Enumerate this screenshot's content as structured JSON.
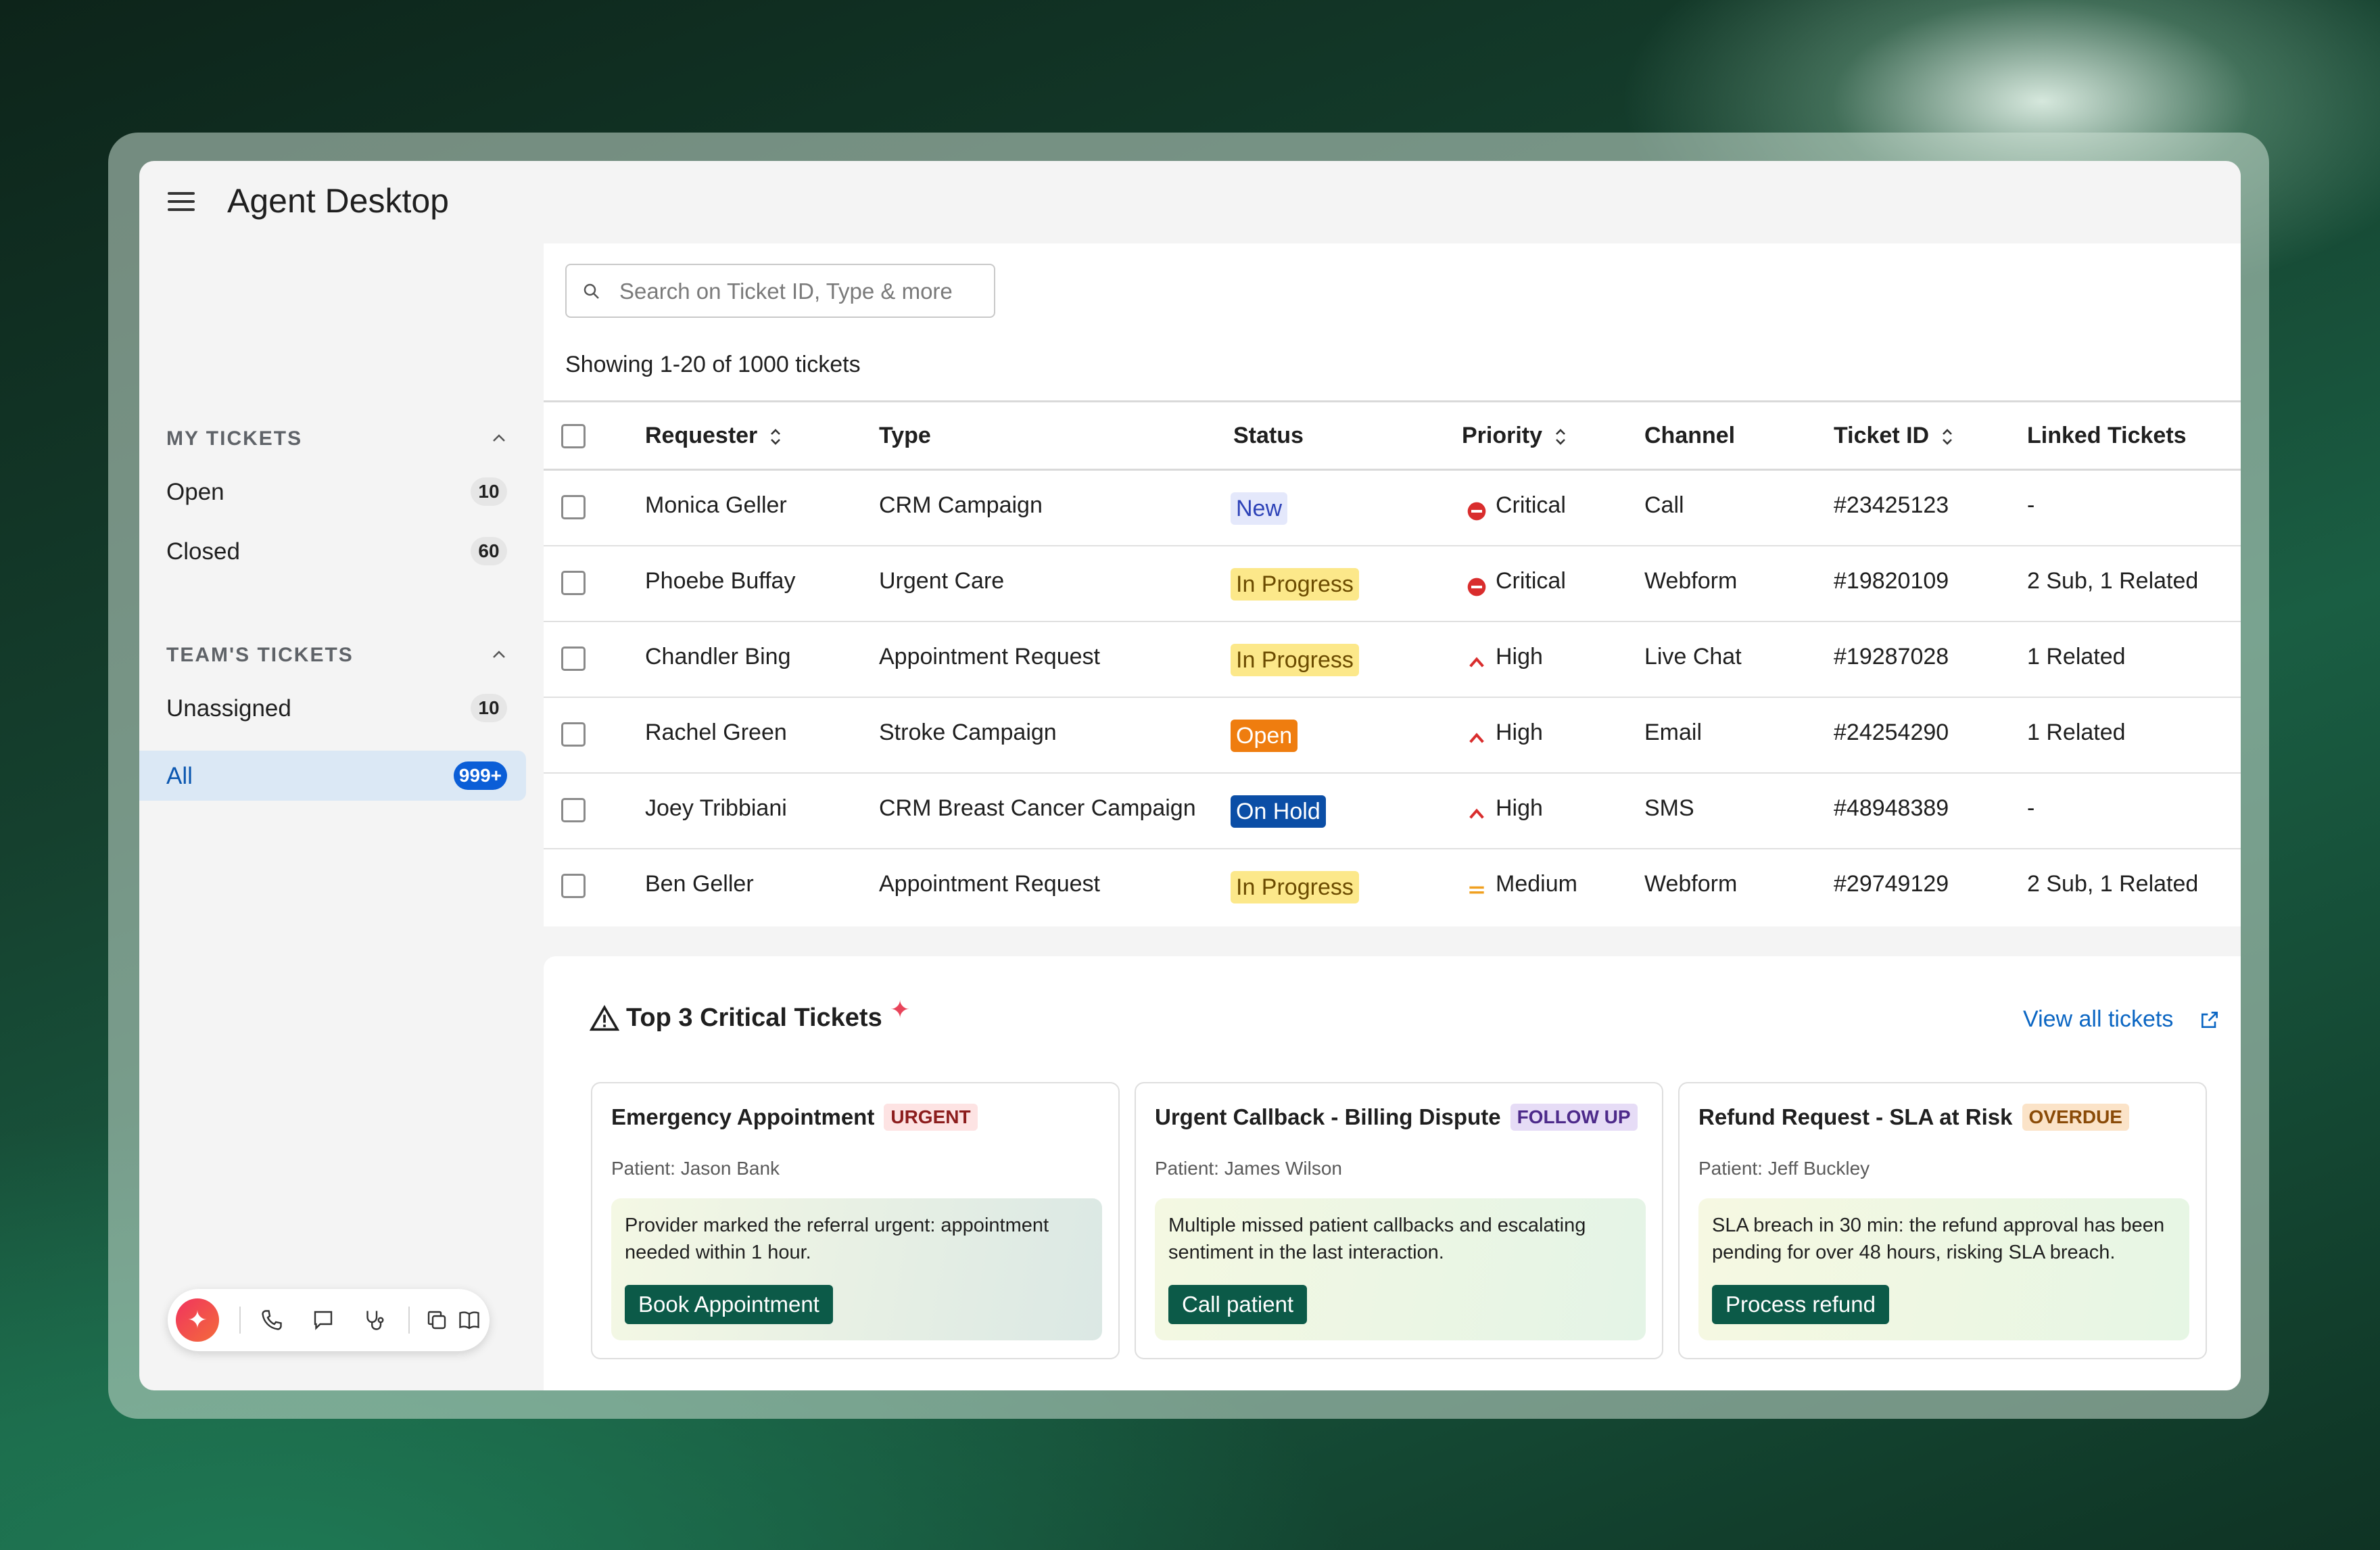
{
  "app": {
    "title": "Agent Desktop"
  },
  "sidebar": {
    "my_tickets": {
      "header": "MY TICKETS",
      "items": [
        {
          "label": "Open",
          "count": "10"
        },
        {
          "label": "Closed",
          "count": "60"
        }
      ]
    },
    "team_tickets": {
      "header": "TEAM'S TICKETS",
      "items": [
        {
          "label": "Unassigned",
          "count": "10"
        },
        {
          "label": "All",
          "count": "999+",
          "active": true
        }
      ]
    },
    "toolbar_icons": [
      "sparkle-icon",
      "phone-icon",
      "chat-icon",
      "stethoscope-icon",
      "copy-icon",
      "book-icon"
    ]
  },
  "search": {
    "placeholder": "Search on Ticket ID, Type & more"
  },
  "table": {
    "showing": "Showing 1-20 of 1000 tickets",
    "headers": {
      "requester": "Requester",
      "type": "Type",
      "status": "Status",
      "priority": "Priority",
      "channel": "Channel",
      "ticket_id": "Ticket ID",
      "linked": "Linked Tickets"
    },
    "rows": [
      {
        "requester": "Monica Geller",
        "type": "CRM Campaign",
        "status": "New",
        "priority": "Critical",
        "channel": "Call",
        "ticket_id": "#23425123",
        "linked": "-"
      },
      {
        "requester": "Phoebe Buffay",
        "type": "Urgent Care",
        "status": "In Progress",
        "priority": "Critical",
        "channel": "Webform",
        "ticket_id": "#19820109",
        "linked": "2 Sub, 1 Related"
      },
      {
        "requester": "Chandler Bing",
        "type": "Appointment Request",
        "status": "In Progress",
        "priority": "High",
        "channel": "Live Chat",
        "ticket_id": "#19287028",
        "linked": "1 Related"
      },
      {
        "requester": "Rachel Green",
        "type": "Stroke Campaign",
        "status": "Open",
        "priority": "High",
        "channel": "Email",
        "ticket_id": "#24254290",
        "linked": "1 Related"
      },
      {
        "requester": "Joey Tribbiani",
        "type": "CRM Breast Cancer Campaign",
        "status": "On Hold",
        "priority": "High",
        "channel": "SMS",
        "ticket_id": "#48948389",
        "linked": "-"
      },
      {
        "requester": "Ben Geller",
        "type": "Appointment Request",
        "status": "In Progress",
        "priority": "Medium",
        "channel": "Webform",
        "ticket_id": "#29749129",
        "linked": "2 Sub, 1 Related"
      }
    ]
  },
  "critical": {
    "title": "Top 3 Critical Tickets",
    "view_all": "View all tickets",
    "cards": [
      {
        "title": "Emergency Appointment",
        "tag": "URGENT",
        "patient": "Patient: Jason Bank",
        "description": "Provider marked the referral urgent: appointment needed within 1 hour.",
        "action": "Book Appointment"
      },
      {
        "title": "Urgent Callback - Billing Dispute",
        "tag": "FOLLOW UP",
        "patient": "Patient: James Wilson",
        "description": "Multiple missed patient callbacks and escalating sentiment in the last interaction.",
        "action": "Call patient"
      },
      {
        "title": "Refund Request - SLA at Risk",
        "tag": "OVERDUE",
        "patient": "Patient: Jeff Buckley",
        "description": "SLA breach in 30 min: the refund approval has been pending for over 48 hours, risking SLA breach.",
        "action": "Process refund"
      }
    ]
  },
  "colors": {
    "accent": "#0b5ed7",
    "critical": "#d92d2d",
    "high": "#d92d2d",
    "medium": "#f0a020",
    "action_button": "#0c5a48"
  }
}
